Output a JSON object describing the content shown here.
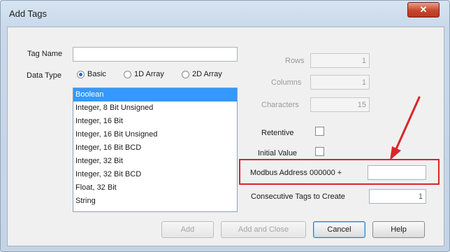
{
  "window": {
    "title": "Add Tags",
    "close_glyph": "✕"
  },
  "form": {
    "tag_name_label": "Tag Name",
    "tag_name_value": "",
    "data_type_label": "Data Type",
    "data_type_options": [
      "Basic",
      "1D Array",
      "2D Array"
    ],
    "data_type_selected": "Basic",
    "types": [
      "Boolean",
      "Integer, 8 Bit Unsigned",
      "Integer, 16 Bit",
      "Integer, 16 Bit Unsigned",
      "Integer, 16 Bit BCD",
      "Integer, 32 Bit",
      "Integer, 32 Bit BCD",
      "Float, 32 Bit",
      "String"
    ],
    "types_selected_index": 0,
    "rows_label": "Rows",
    "rows_value": "1",
    "columns_label": "Columns",
    "columns_value": "1",
    "characters_label": "Characters",
    "characters_value": "15",
    "retentive_label": "Retentive",
    "initial_value_label": "Initial Value",
    "modbus_label": "Modbus Address 000000 +",
    "modbus_value": "",
    "consecutive_label": "Consecutive Tags to Create",
    "consecutive_value": "1"
  },
  "buttons": {
    "add": "Add",
    "add_and_close": "Add and Close",
    "cancel": "Cancel",
    "help": "Help"
  },
  "colors": {
    "highlight": "#d8262c",
    "selection": "#3399ff"
  }
}
